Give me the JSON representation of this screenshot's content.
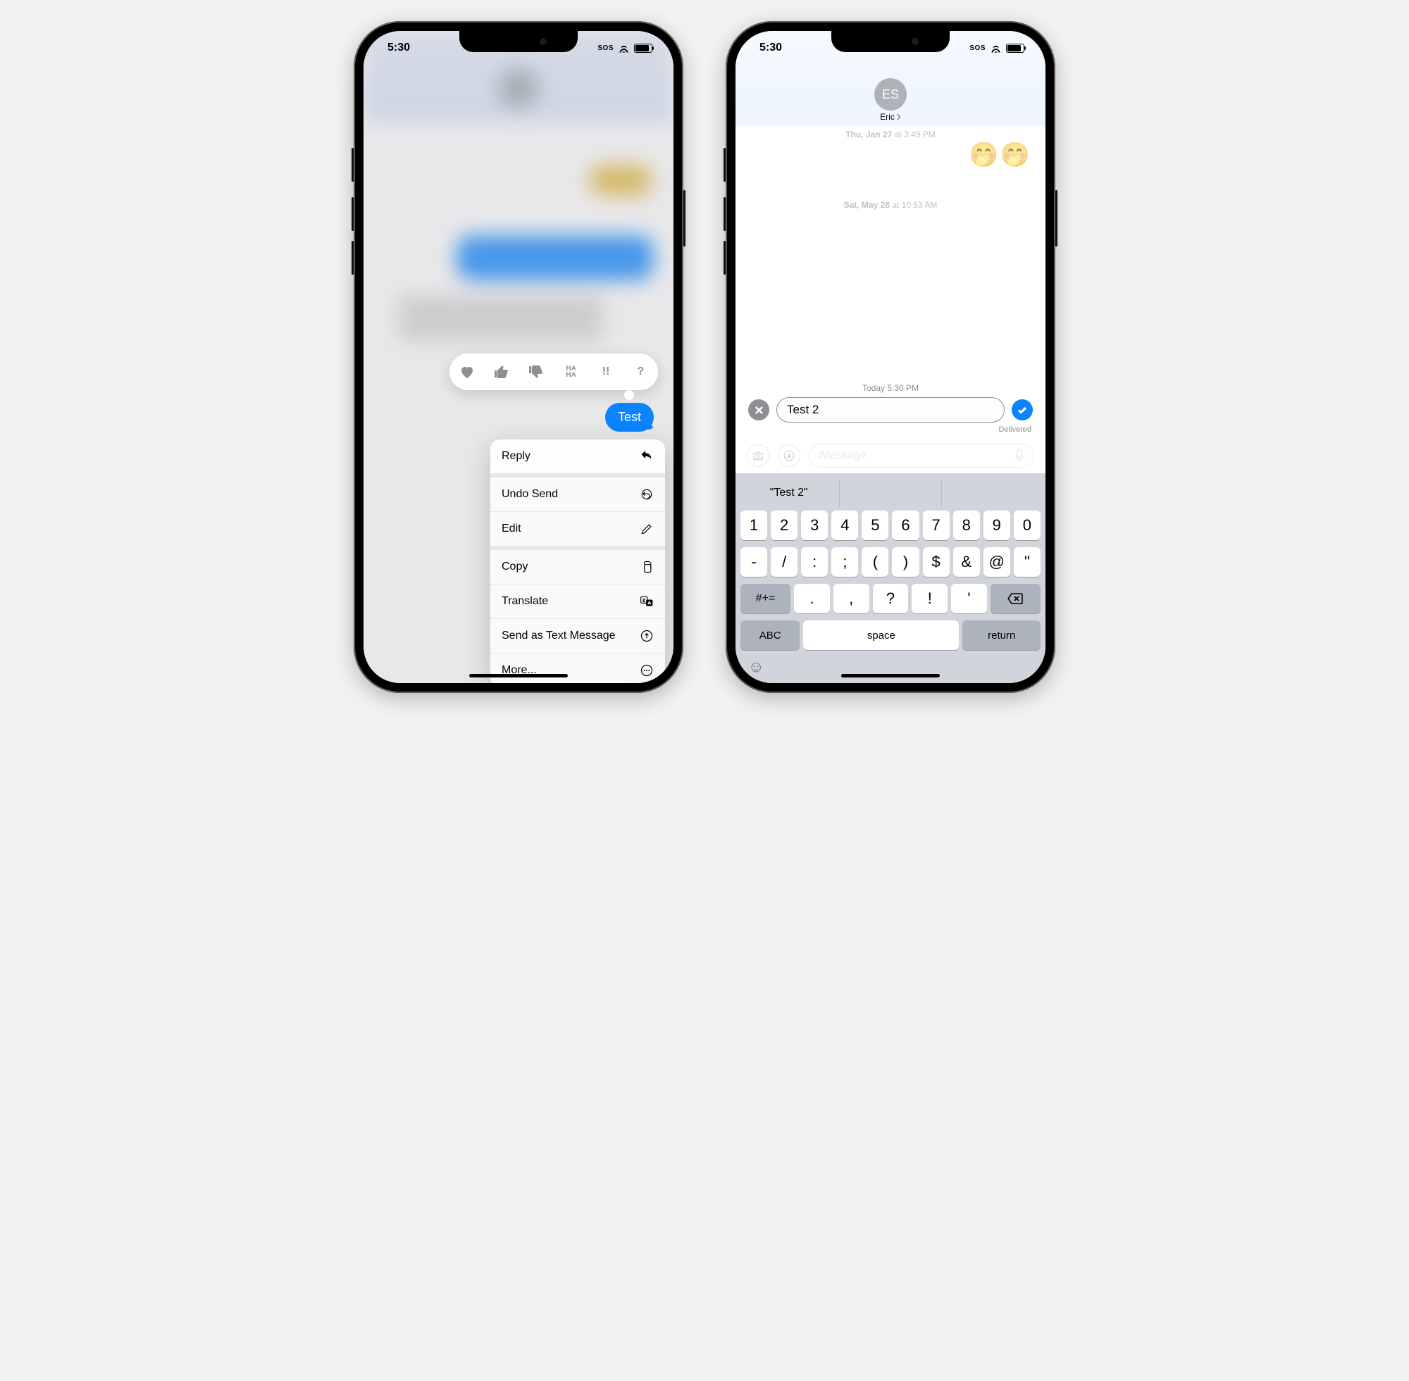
{
  "status": {
    "time": "5:30",
    "sos": "SOS"
  },
  "left": {
    "tapbacks": [
      "heart",
      "thumbs-up",
      "thumbs-down",
      "haha",
      "exclaim",
      "question"
    ],
    "tapback_labels": {
      "haha": "HA\nHA",
      "exclaim": "!!",
      "question": "?"
    },
    "selected_bubble": "Test",
    "menu": [
      {
        "id": "reply",
        "label": "Reply",
        "icon": "reply",
        "hl": true
      },
      {
        "sep": true
      },
      {
        "id": "undo",
        "label": "Undo Send",
        "icon": "undo"
      },
      {
        "id": "edit",
        "label": "Edit",
        "icon": "pencil"
      },
      {
        "sep": true
      },
      {
        "id": "copy",
        "label": "Copy",
        "icon": "copy"
      },
      {
        "id": "translate",
        "label": "Translate",
        "icon": "translate"
      },
      {
        "id": "sendsms",
        "label": "Send as Text Message",
        "icon": "arrow-up-circle"
      },
      {
        "id": "more",
        "label": "More...",
        "icon": "ellipsis"
      }
    ]
  },
  "right": {
    "avatar_initials": "ES",
    "contact_name": "Eric",
    "timestamps": {
      "t1": {
        "day": "Thu, Jan 27",
        "time": "3:49 PM"
      },
      "t2": {
        "day": "Sat, May 28",
        "time": "10:53 AM"
      },
      "today": "Today 5:30 PM"
    },
    "emoji_message": "🤭🤭",
    "edit_value": "Test 2",
    "delivered": "Delivered",
    "compose_placeholder": "iMessage",
    "keyboard": {
      "suggestion": "\"Test 2\"",
      "row1": [
        "1",
        "2",
        "3",
        "4",
        "5",
        "6",
        "7",
        "8",
        "9",
        "0"
      ],
      "row2": [
        "-",
        "/",
        ":",
        ";",
        "(",
        ")",
        "$",
        "&",
        "@",
        "\""
      ],
      "row3_shift": "#+=",
      "row3": [
        ".",
        ",",
        "?",
        "!",
        "'"
      ],
      "abc": "ABC",
      "space": "space",
      "return": "return"
    }
  }
}
